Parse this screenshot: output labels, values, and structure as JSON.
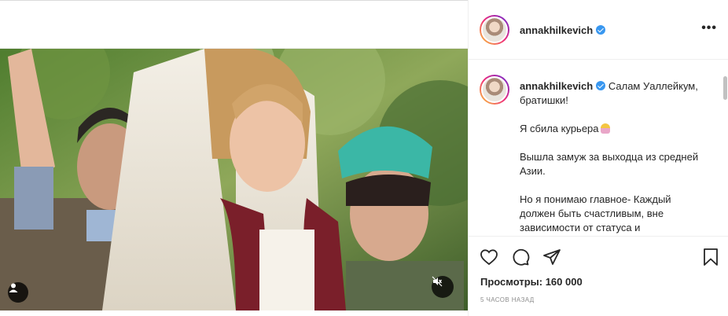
{
  "header": {
    "username": "annakhilkevich",
    "more_label": "•••"
  },
  "caption": {
    "username": "annakhilkevich",
    "lines": [
      "Салам Уаллейкум, братишки!",
      "Я сбила курьера",
      "Вышла замуж за выходца из средней Азии.",
      "Но я понимаю главное- Каждый должен быть счастливым, вне зависимости от статуса и"
    ],
    "emoji": "woman-blonde-emoji"
  },
  "actions": {
    "views_label": "Просмотры: 160 000",
    "time_label": "5 часов назад"
  },
  "icons": {
    "like": "heart-icon",
    "comment": "comment-icon",
    "share": "paper-plane-icon",
    "save": "bookmark-icon",
    "tag": "user-tag-icon",
    "mute": "muted-speaker-icon"
  },
  "colors": {
    "verified": "#3897f0",
    "text": "#262626",
    "secondary": "#8e8e8e"
  }
}
